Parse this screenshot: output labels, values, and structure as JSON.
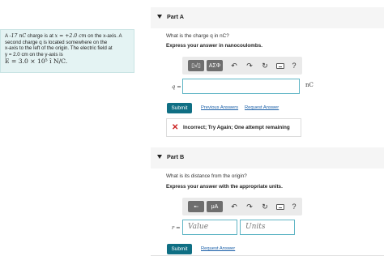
{
  "problem": {
    "line1_prefix": "A ",
    "line1_charge": "-17 nC",
    "line1_mid": " charge is at ",
    "line1_var": "x = +2.0 cm",
    "line1_suffix": " on the x-axis. A",
    "line2": "second charge q is located somewhere on the",
    "line3": "x-axis to the left of the origin. The electric field at",
    "line4": "y = 2.0 cm on the y-axis is",
    "field": "E = 3.0 × 10⁵ î N/C."
  },
  "part_a": {
    "title": "Part A",
    "question": "What is the charge q in nC?",
    "instruction": "Express your answer in nanocoulombs.",
    "toolbar": {
      "template_label": "▯√▯",
      "symbols_label": "ΑΣΦ",
      "undo_glyph": "↶",
      "redo_glyph": "↷",
      "reset_glyph": "↻",
      "help_glyph": "?"
    },
    "input_label": "q =",
    "input_value": "",
    "unit": "nC",
    "submit_label": "Submit",
    "previous_answers_label": "Previous Answers",
    "request_answer_label": "Request Answer",
    "feedback_icon": "✕",
    "feedback_text": "Incorrect; Try Again; One attempt remaining"
  },
  "part_b": {
    "title": "Part B",
    "question": "What is its distance from the origin?",
    "instruction": "Express your answer with the appropriate units.",
    "toolbar": {
      "template_label": "▪▫",
      "units_label": "μA",
      "undo_glyph": "↶",
      "redo_glyph": "↷",
      "reset_glyph": "↻",
      "help_glyph": "?"
    },
    "input_label": "r =",
    "value_placeholder": "Value",
    "units_placeholder": "Units",
    "submit_label": "Submit",
    "request_answer_label": "Request Answer"
  },
  "colors": {
    "problem_bg": "#e4f3f3",
    "submit_bg": "#0f6f84",
    "link": "#1a5fa8",
    "input_border": "#5fb5c5",
    "error": "#cc2222"
  }
}
